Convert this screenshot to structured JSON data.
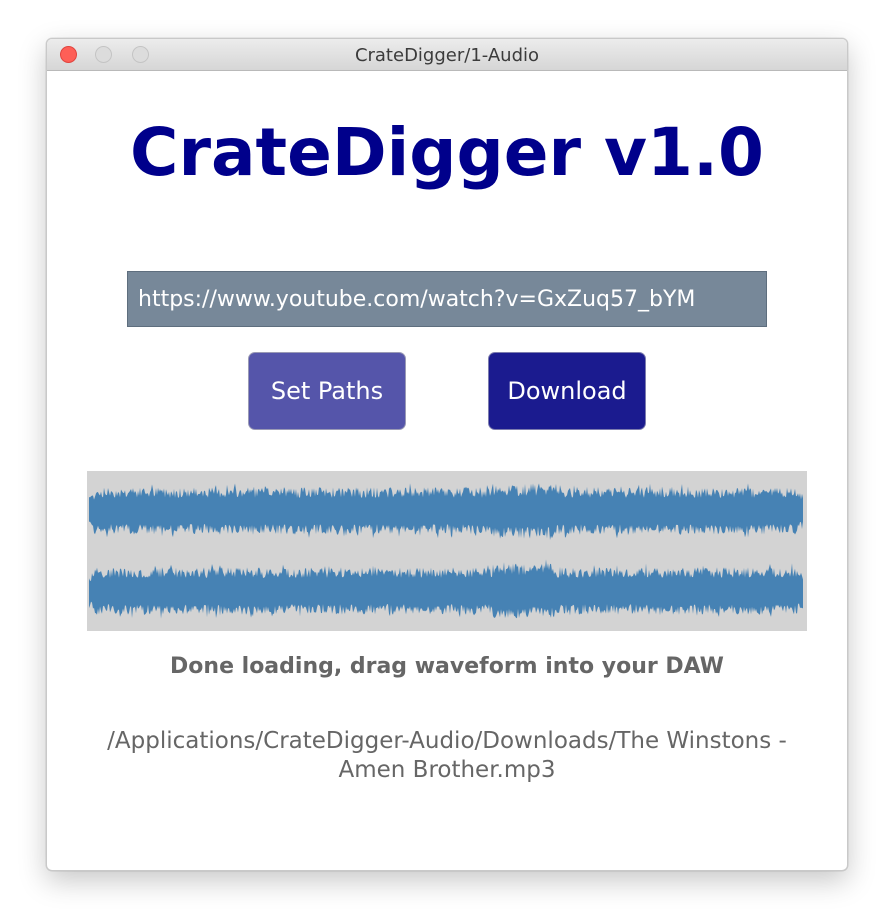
{
  "window": {
    "title": "CrateDigger/1-Audio"
  },
  "app": {
    "title": "CrateDigger v1.0"
  },
  "url_input": {
    "value": "https://www.youtube.com/watch?v=GxZuq57_bYM",
    "background": "#778899"
  },
  "buttons": {
    "set_paths_label": "Set Paths",
    "download_label": "Download"
  },
  "waveform": {
    "channels": 2,
    "background": "#d3d3d3",
    "color": "#4682b4"
  },
  "status": {
    "message": "Done loading, drag waveform into your DAW",
    "file_path": "/Applications/CrateDigger-Audio/Downloads/The Winstons - Amen Brother.mp3"
  },
  "colors": {
    "title": "#00008b",
    "set_paths_button": "#5555aa",
    "download_button": "#1b1b8f",
    "status_text": "#666666"
  }
}
